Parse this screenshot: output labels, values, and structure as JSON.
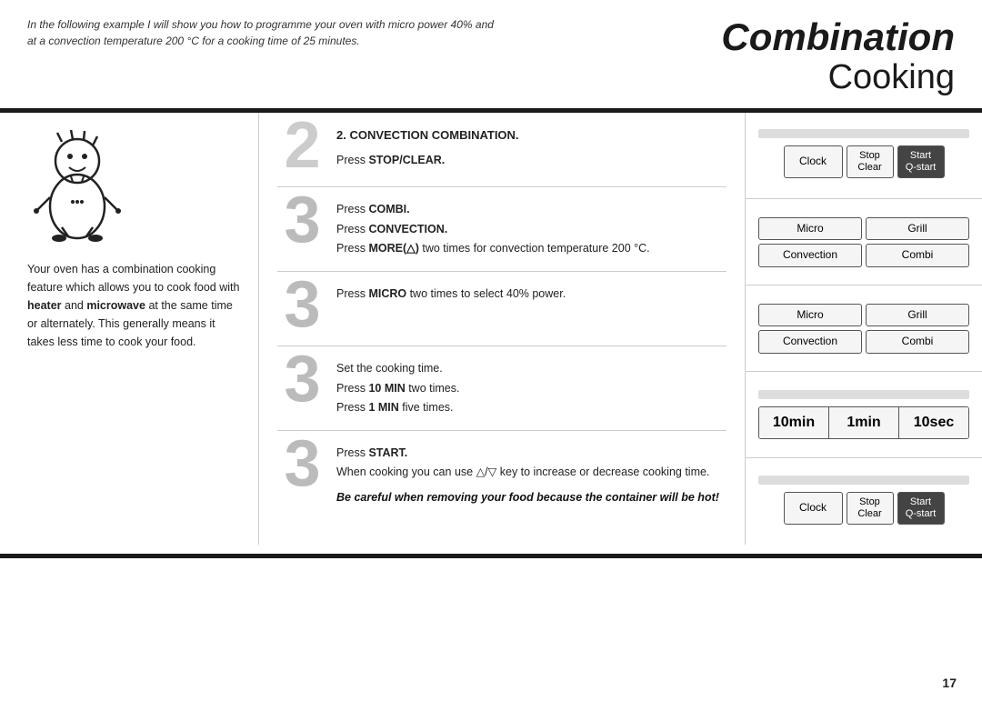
{
  "header": {
    "intro_text": "In the following example I will show you how to programme your oven with micro power 40% and at a convection temperature 200 °C for a cooking time of 25 minutes.",
    "title_combination": "Combination",
    "title_cooking": "Cooking"
  },
  "left": {
    "description": "Your oven has a combination cooking feature which allows you to cook food with heater and microwave at the same time or alternately. This generally means it takes less time to cook your food."
  },
  "steps": [
    {
      "number": "2",
      "heading": "2. CONVECTION COMBINATION.",
      "lines": [
        {
          "text": "Press ",
          "bold": "STOP/CLEAR.",
          "rest": ""
        }
      ]
    },
    {
      "number": "3",
      "heading": "",
      "lines": [
        {
          "text": "Press ",
          "bold": "COMBI.",
          "rest": ""
        },
        {
          "text": "Press ",
          "bold": "CONVECTION.",
          "rest": ""
        },
        {
          "text": "Press ",
          "bold": "MORE(",
          "rest": " ) two times for convection temperature 200 °C."
        }
      ]
    },
    {
      "number": "3",
      "heading": "",
      "lines": [
        {
          "text": "Press ",
          "bold": "MICRO",
          "rest": " two times to select 40% power."
        }
      ]
    },
    {
      "number": "3",
      "heading": "",
      "lines": [
        {
          "text": "Set the cooking time.",
          "bold": "",
          "rest": ""
        },
        {
          "text": "Press ",
          "bold": "10 MIN",
          "rest": " two times."
        },
        {
          "text": "Press ",
          "bold": "1 MIN",
          "rest": " five times."
        }
      ]
    },
    {
      "number": "3",
      "heading": "",
      "lines": [
        {
          "text": "Press ",
          "bold": "START.",
          "rest": ""
        },
        {
          "text": "When cooking you can use ",
          "bold": "",
          "rest": "△ / ▽  key to increase or decrease cooking time."
        }
      ],
      "warning": "Be careful when removing your food because the container will be hot!"
    }
  ],
  "panels": [
    {
      "type": "clock_stop_start",
      "clock": "Clock",
      "stop_clear": [
        "Stop",
        "Clear"
      ],
      "start": [
        "Start",
        "Q-start"
      ]
    },
    {
      "type": "button_grid",
      "buttons": [
        "Micro",
        "Grill",
        "Convection",
        "Combi"
      ]
    },
    {
      "type": "button_grid",
      "buttons": [
        "Micro",
        "Grill",
        "Convection",
        "Combi"
      ]
    },
    {
      "type": "time_display",
      "cells": [
        "10min",
        "1min",
        "10sec"
      ]
    },
    {
      "type": "clock_stop_start",
      "clock": "Clock",
      "stop_clear": [
        "Stop",
        "Clear"
      ],
      "start": [
        "Start",
        "Q-start"
      ]
    }
  ],
  "page_number": "17"
}
